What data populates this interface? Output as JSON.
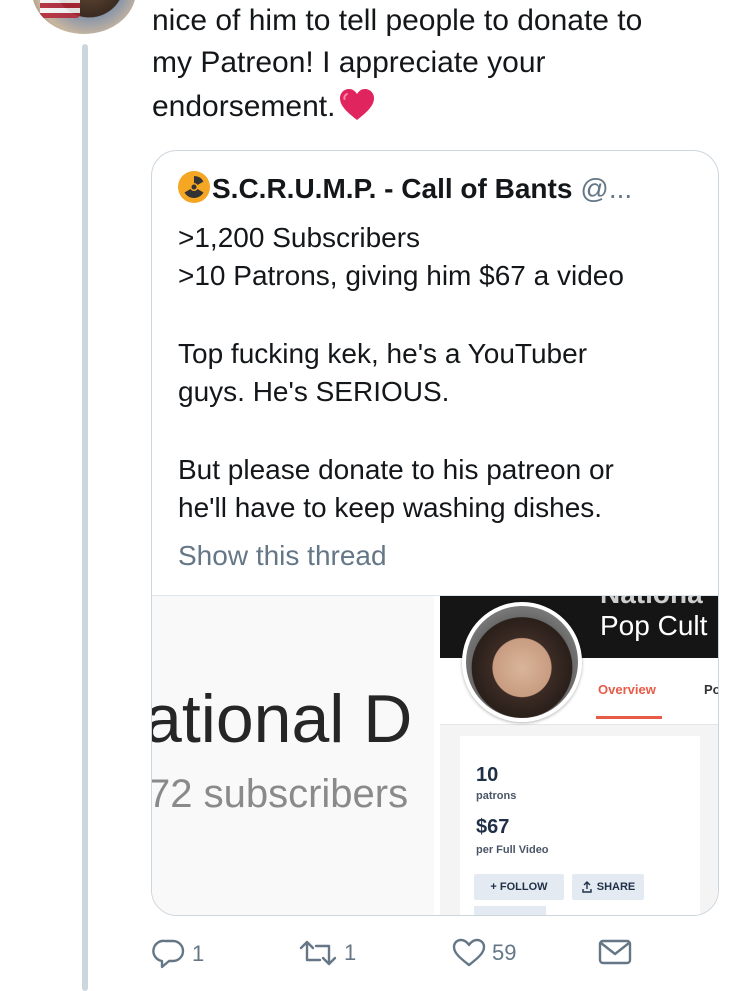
{
  "tweet": {
    "text_line1": "nice of him to tell people to donate to",
    "text_line2": "my Patreon! I appreciate your",
    "text_line3": "endorsement.",
    "emoji": "red-heart"
  },
  "quoted_tweet": {
    "name": "S.C.R.U.M.P. - Call of Bants",
    "handle": "@...",
    "body": [
      ">1,200 Subscribers",
      ">10 Patrons, giving him $67 a video",
      "",
      "Top fucking kek, he's a YouTuber",
      "guys. He's SERIOUS.",
      "",
      "But please donate to his patreon or",
      "he'll have to keep washing dishes."
    ],
    "show_thread": "Show this thread"
  },
  "media_left": {
    "title_fragment": "ational D",
    "subscribers_fragment": "72 subscribers"
  },
  "media_right": {
    "banner_top": "Nationa",
    "banner_text": "Pop Cult",
    "tab_overview": "Overview",
    "tab_partial": "Po",
    "patrons_count": "10",
    "patrons_label": "patrons",
    "amount": "$67",
    "per_label": "per Full Video",
    "follow_label": "+ FOLLOW",
    "share_label": "SHARE"
  },
  "actions": {
    "replies": "1",
    "retweets": "1",
    "likes": "59"
  },
  "colors": {
    "text": "#14171a",
    "muted": "#657786",
    "border": "#ccd6dd",
    "patreon_accent": "#e85b46",
    "heart": "#e0245e"
  }
}
